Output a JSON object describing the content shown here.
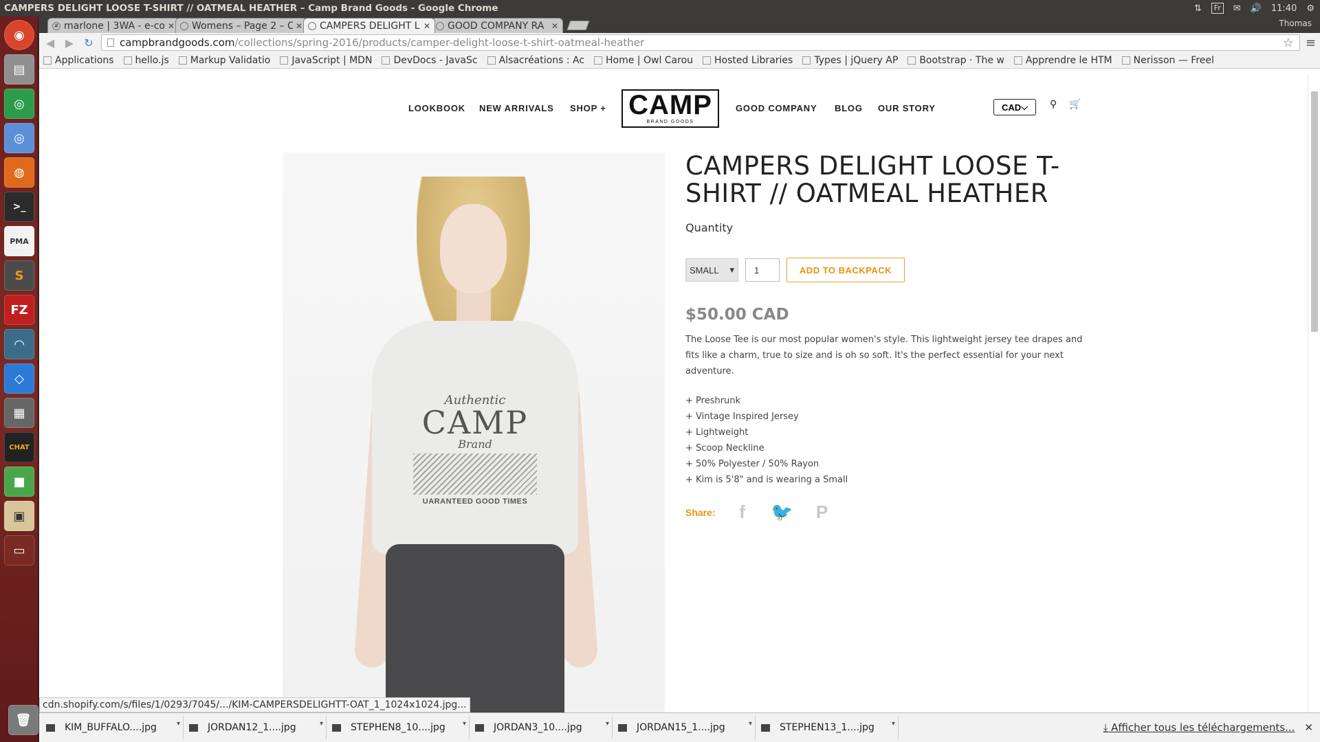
{
  "system": {
    "window_title": "CAMPERS DELIGHT LOOSE T-SHIRT // OATMEAL HEATHER – Camp Brand Goods - Google Chrome",
    "lang": "Fr",
    "time": "11:40",
    "user": "Thomas"
  },
  "tabs": [
    {
      "label": "marlone | 3WA - e-co",
      "active": false
    },
    {
      "label": "Womens – Page 2 – C",
      "active": false
    },
    {
      "label": "CAMPERS DELIGHT L",
      "active": true
    },
    {
      "label": "GOOD COMPANY RA",
      "active": false
    }
  ],
  "address": {
    "host": "campbrandgoods.com",
    "path": "/collections/spring-2016/products/camper-delight-loose-t-shirt-oatmeal-heather"
  },
  "bookmarks": [
    "Applications",
    "hello.js",
    "Markup Validatio",
    "JavaScript | MDN",
    "DevDocs - JavaSc",
    "Alsacréations : Ac",
    "Home | Owl Carou",
    "Hosted Libraries",
    "Types | jQuery AP",
    "Bootstrap · The w",
    "Apprendre le HTM",
    "Nerisson — Freel"
  ],
  "site_nav": {
    "lookbook": "LOOKBOOK",
    "new_arrivals": "NEW ARRIVALS",
    "shop": "SHOP +",
    "logo_main": "CAMP",
    "logo_sub": "BRAND GOODS",
    "good_company": "GOOD COMPANY",
    "blog": "BLOG",
    "our_story": "OUR STORY",
    "currency": "CAD"
  },
  "product": {
    "title": "CAMPERS DELIGHT LOOSE T-SHIRT // OATMEAL HEATHER",
    "quantity_label": "Quantity",
    "size": "SMALL",
    "qty": "1",
    "add_button": "ADD TO BACKPACK",
    "price": "$50.00 CAD",
    "description": "The Loose Tee is our most popular women's style. This lightweight jersey tee drapes and fits like a charm, true to size and is oh so soft. It's the perfect essential for your next adventure.",
    "features": [
      "+ Preshrunk",
      "+ Vintage Inspired Jersey",
      "+ Lightweight",
      "+ Scoop Neckline",
      "+ 50% Polyester / 50% Rayon",
      "+ Kim is 5'8\" and is wearing a Small"
    ],
    "share_label": "Share:",
    "shirt_print": {
      "line1": "Authentic",
      "line2": "CAMP",
      "line3": "Brand",
      "line4": "UARANTEED GOOD TIMES"
    }
  },
  "status_url": "cdn.shopify.com/s/files/1/0293/7045/.../KIM-CAMPERSDELIGHTT-OAT_1_1024x1024.jpg...",
  "downloads": [
    "KIM_BUFFALO....jpg",
    "JORDAN12_1....jpg",
    "STEPHEN8_10....jpg",
    "JORDAN3_10....jpg",
    "JORDAN15_1....jpg",
    "STEPHEN13_1....jpg"
  ],
  "downloads_show_all": "Afficher tous les téléchargements...",
  "colors": {
    "accent": "#e8940c",
    "launcher": "#6b1f1f"
  }
}
